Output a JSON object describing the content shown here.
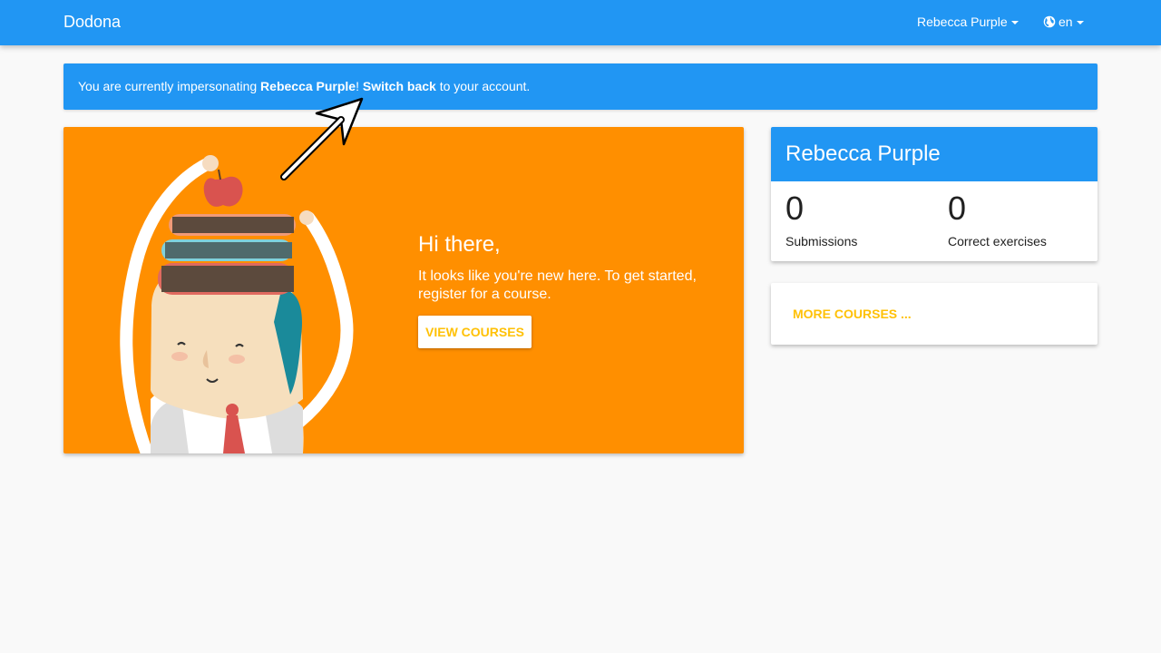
{
  "navbar": {
    "brand": "Dodona",
    "user_menu": "Rebecca Purple",
    "language": "en",
    "globe_icon": "globe-icon",
    "caret_icon": "caret-down-icon"
  },
  "alert": {
    "prefix": "You are currently impersonating ",
    "user": "Rebecca Purple",
    "bang": "! ",
    "link": "Switch back",
    "suffix": " to your account."
  },
  "hero": {
    "title": "Hi there,",
    "text": "It looks like you're new here. To get started, register for a course.",
    "button": "VIEW COURSES"
  },
  "profile": {
    "name": "Rebecca Purple",
    "stats": [
      {
        "value": "0",
        "label": "Submissions"
      },
      {
        "value": "0",
        "label": "Correct exercises"
      }
    ]
  },
  "courses": {
    "more": "MORE COURSES ..."
  },
  "colors": {
    "primary": "#2196f3",
    "hero_bg": "#ff8f00",
    "accent": "#ffc107",
    "page_bg": "#f9f9f9"
  }
}
